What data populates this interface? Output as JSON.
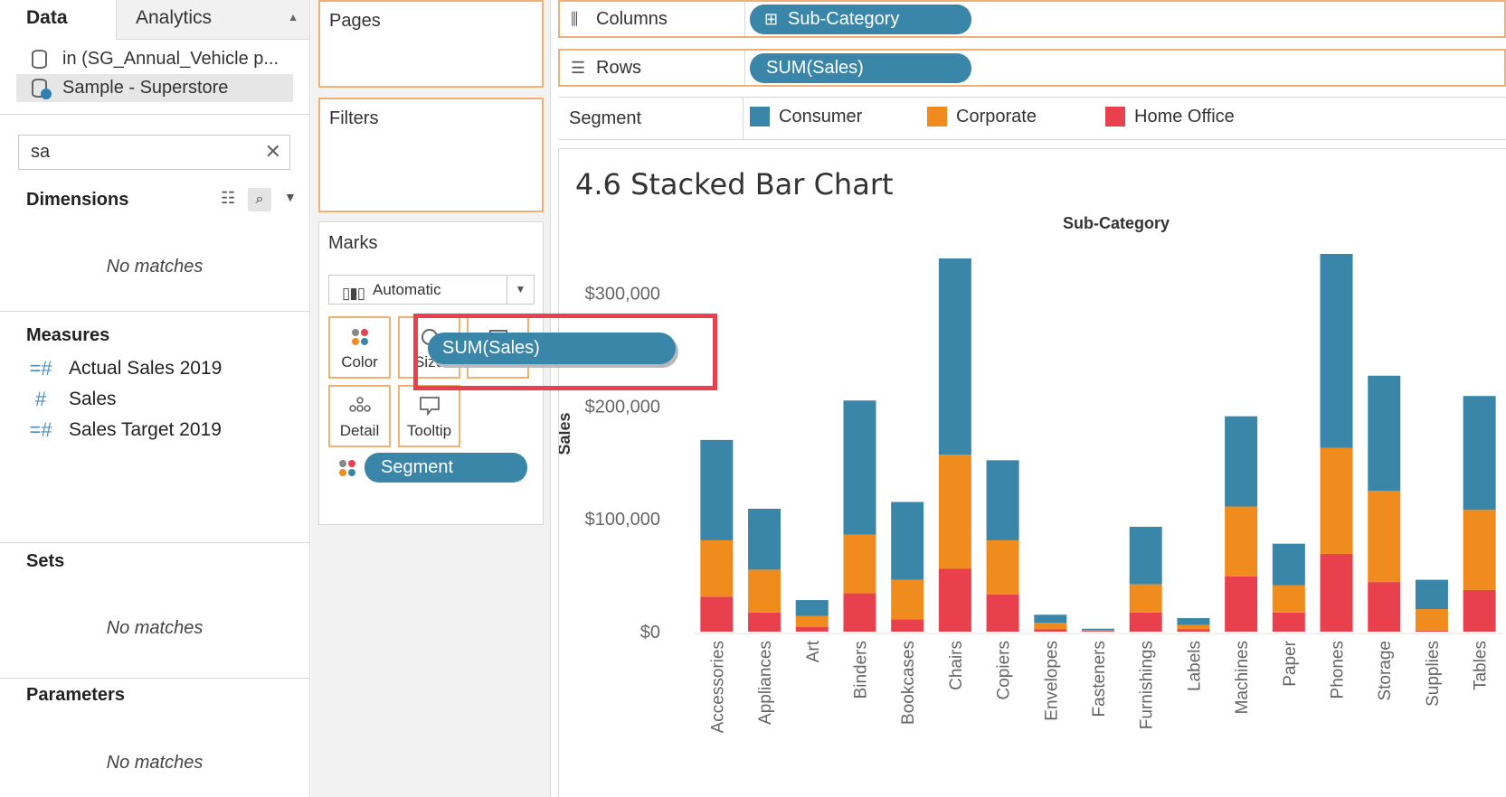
{
  "data_pane": {
    "tabs": {
      "data": "Data",
      "analytics": "Analytics"
    },
    "datasources": [
      {
        "label": "in (SG_Annual_Vehicle p..."
      },
      {
        "label": "Sample - Superstore"
      }
    ],
    "search": {
      "value": "sa"
    },
    "dimensions": {
      "title": "Dimensions",
      "empty": "No matches"
    },
    "measures": {
      "title": "Measures",
      "items": [
        "Actual Sales 2019",
        "Sales",
        "Sales Target 2019"
      ]
    },
    "sets": {
      "title": "Sets",
      "empty": "No matches"
    },
    "parameters": {
      "title": "Parameters",
      "empty": "No matches"
    }
  },
  "cards": {
    "pages": "Pages",
    "filters": "Filters",
    "marks": {
      "title": "Marks",
      "type": "Automatic",
      "buttons": {
        "color": "Color",
        "size": "Size",
        "label": "Label",
        "detail": "Detail",
        "tooltip": "Tooltip"
      },
      "field_pill": "Segment"
    }
  },
  "shelves": {
    "columns": {
      "label": "Columns",
      "pill": "Sub-Category"
    },
    "rows": {
      "label": "Rows",
      "pill": "SUM(Sales)"
    },
    "segment": {
      "label": "Segment",
      "legend": [
        {
          "name": "Consumer",
          "color": "#3a86a8"
        },
        {
          "name": "Corporate",
          "color": "#f08c1e"
        },
        {
          "name": "Home Office",
          "color": "#e8414d"
        }
      ]
    }
  },
  "drag_pill": "SUM(Sales)",
  "chart_data": {
    "type": "bar",
    "stacked": true,
    "title": "4.6 Stacked Bar Chart",
    "header": "Sub-Category",
    "ylabel": "Sales",
    "ylim": [
      0,
      335000
    ],
    "yticks": [
      {
        "value": 0,
        "label": "$0"
      },
      {
        "value": 100000,
        "label": "$100,000"
      },
      {
        "value": 200000,
        "label": "$200,000"
      },
      {
        "value": 300000,
        "label": "$300,000"
      }
    ],
    "categories": [
      "Accessories",
      "Appliances",
      "Art",
      "Binders",
      "Bookcases",
      "Chairs",
      "Copiers",
      "Envelopes",
      "Fasteners",
      "Furnishings",
      "Labels",
      "Machines",
      "Paper",
      "Phones",
      "Storage",
      "Supplies",
      "Tables"
    ],
    "series": [
      {
        "name": "Home Office",
        "color": "#e8414d",
        "values": [
          31000,
          17000,
          4000,
          34000,
          11000,
          56000,
          33000,
          2000,
          700,
          17000,
          2000,
          49000,
          17000,
          69000,
          44000,
          1000,
          37000
        ]
      },
      {
        "name": "Corporate",
        "color": "#f08c1e",
        "values": [
          50000,
          38000,
          10000,
          52000,
          35000,
          101000,
          48000,
          6000,
          900,
          25000,
          4000,
          62000,
          24000,
          94000,
          81000,
          19000,
          71000
        ]
      },
      {
        "name": "Consumer",
        "color": "#3a86a8",
        "values": [
          89000,
          54000,
          14000,
          119000,
          69000,
          174000,
          71000,
          7000,
          1000,
          51000,
          6000,
          80000,
          37000,
          172000,
          102000,
          26000,
          101000
        ]
      }
    ]
  }
}
